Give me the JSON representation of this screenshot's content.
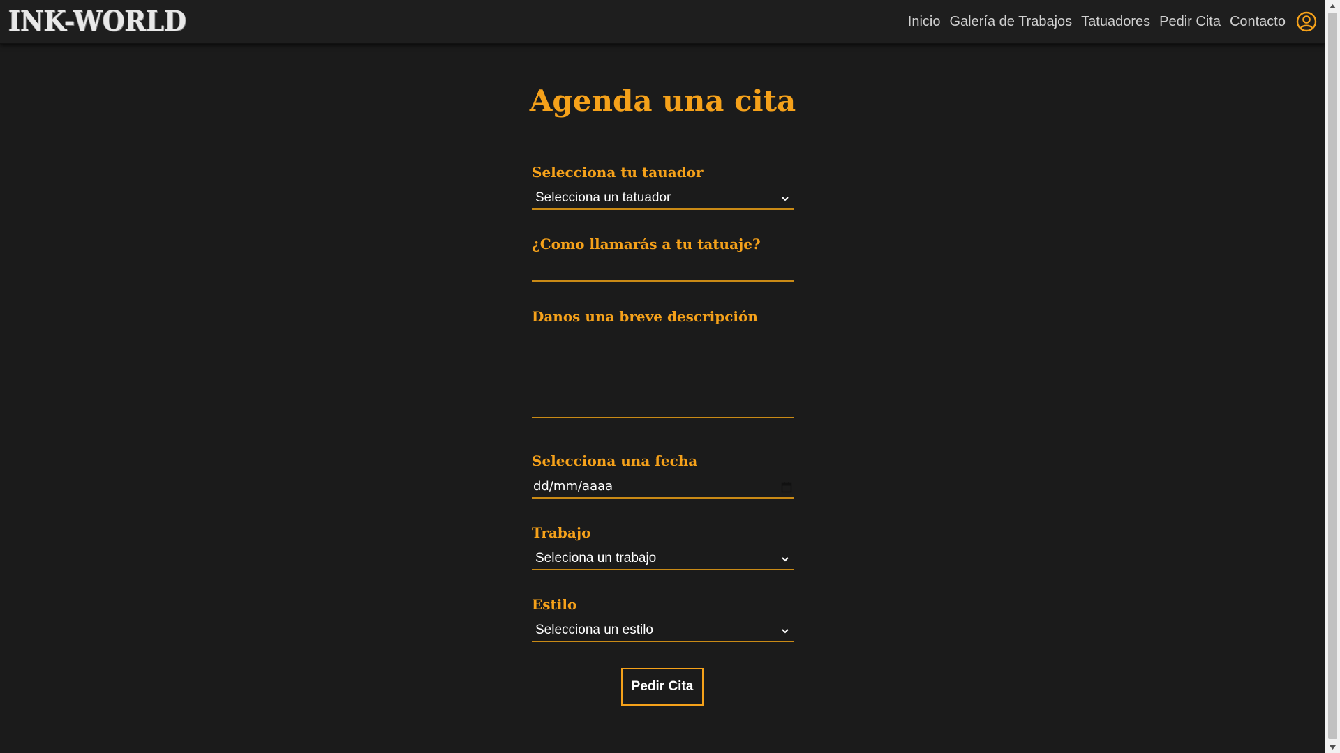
{
  "navbar": {
    "logo": "INK-WORLD",
    "links": [
      "Inicio",
      "Galería de Trabajos",
      "Tatuadores",
      "Pedir Cita",
      "Contacto"
    ],
    "user_icon": "user-circle-icon"
  },
  "form": {
    "title": "Agenda una cita",
    "tattooist": {
      "label": "Selecciona tu tauador",
      "selected": "Selecciona un tatuador"
    },
    "tattoo_name": {
      "label": "¿Como llamarás a tu tatuaje?",
      "value": ""
    },
    "description": {
      "label": "Danos una breve descripción",
      "value": ""
    },
    "date": {
      "label": "Selecciona una fecha",
      "placeholder": "dd/mm/aaaa"
    },
    "job": {
      "label": "Trabajo",
      "selected": "Seleciona un trabajo"
    },
    "style": {
      "label": "Estilo",
      "selected": "Selecciona un estilo"
    },
    "submit_label": "Pedir Cita"
  },
  "colors": {
    "background": "#1b1b1b",
    "accent": "#f5a11a",
    "text": "#ffffff",
    "nav_text": "#d0d0d0"
  }
}
